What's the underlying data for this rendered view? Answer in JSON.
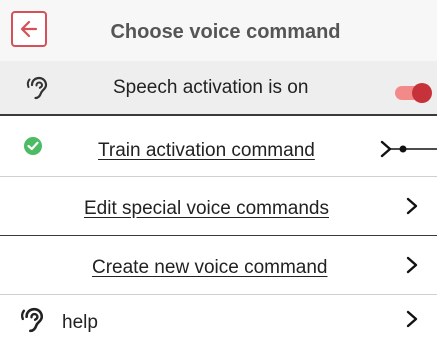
{
  "header": {
    "title": "Choose voice command",
    "back_icon": "arrow-left-icon",
    "accent_color": "#d6505a"
  },
  "activation": {
    "icon": "ear-icon",
    "label": "Speech activation is on",
    "toggle_on": true,
    "toggle_color": "#c7323a"
  },
  "items": [
    {
      "label": "Train activation command",
      "status_icon": "check-circle-icon",
      "status_color": "#4cbb63",
      "chevron": "chevron-right-icon"
    },
    {
      "label": "Edit special voice commands",
      "chevron": "chevron-right-icon"
    },
    {
      "label": "Create new voice command",
      "chevron": "chevron-right-icon"
    },
    {
      "label": "help",
      "icon": "ear-icon",
      "chevron": "chevron-right-icon"
    }
  ]
}
